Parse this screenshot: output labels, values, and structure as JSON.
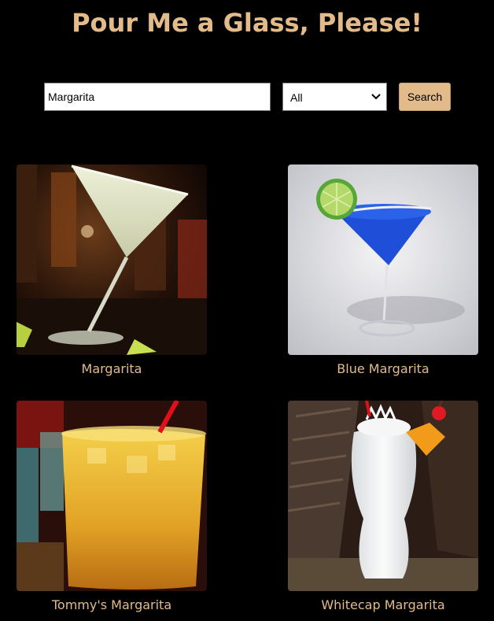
{
  "header": {
    "title": "Pour Me a Glass, Please!"
  },
  "search": {
    "value": "Margarita",
    "category_selected": "All",
    "button_label": "Search"
  },
  "results": [
    {
      "name": "Margarita"
    },
    {
      "name": "Blue Margarita"
    },
    {
      "name": "Tommy's Margarita"
    },
    {
      "name": "Whitecap Margarita"
    }
  ],
  "colors": {
    "background": "#000000",
    "accent": "#e3bb8b"
  }
}
